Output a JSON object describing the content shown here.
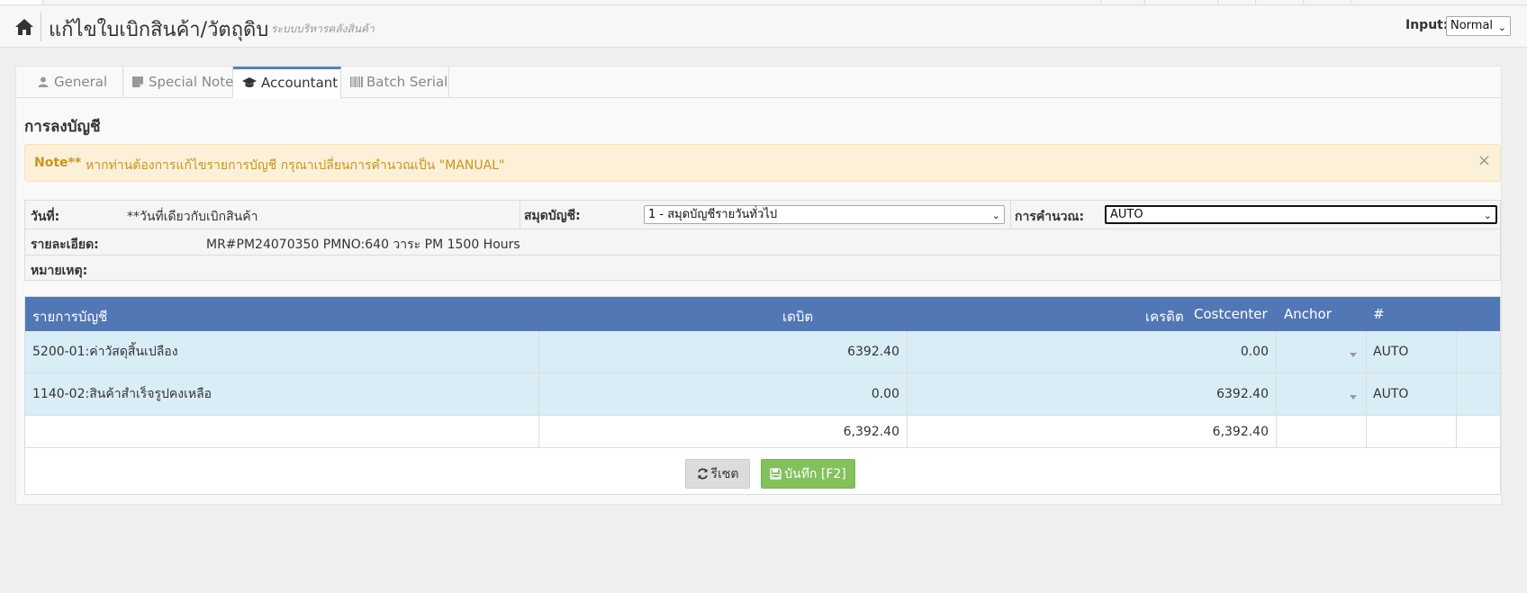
{
  "header": {
    "title": "แก้ไขใบเบิกสินค้า/วัตถุดิบ",
    "subtitle": "ระบบบริหารคลังสินค้า",
    "input_label": "Input:",
    "input_value": "Normal"
  },
  "tabs": [
    {
      "label": "General",
      "icon": "user-icon"
    },
    {
      "label": "Special Note",
      "icon": "sticky-note-icon"
    },
    {
      "label": "Accountant",
      "icon": "graduation-cap-icon",
      "active": true
    },
    {
      "label": "Batch Serial",
      "icon": "barcode-icon"
    }
  ],
  "section": {
    "title": "การลงบัญชี"
  },
  "note": {
    "strong": "Note**",
    "text": "หากท่านต้องการแก้ไขรายการบัญชี กรุณาเปลี่ยนการคำนวณเป็น \"MANUAL\"",
    "close": "×"
  },
  "info": {
    "date_label": "วันที่:",
    "date_value": "**วันที่เดียวกับเบิกสินค้า",
    "journal_label": "สมุดบัญชี:",
    "journal_value": "1 - สมุดบัญชีรายวันทั่วไป",
    "calc_label": "การคำนวณ:",
    "calc_value": "AUTO",
    "detail_label": "รายละเอียด:",
    "detail_value": "MR#PM24070350 PMNO:640  วาระ PM 1500 Hours",
    "remark_label": "หมายเหตุ:"
  },
  "table": {
    "headers": {
      "account": "รายการบัญชี",
      "debit": "เดบิต",
      "credit": "เครดิต",
      "costcenter": "Costcenter",
      "anchor": "Anchor",
      "hash": "#"
    },
    "rows": [
      {
        "account": "5200-01:ค่าวัสดุสิ้นเปลือง",
        "debit": "6392.40",
        "credit": "0.00",
        "anchor": "AUTO"
      },
      {
        "account": "1140-02:สินค้าสำเร็จรูปคงเหลือ",
        "debit": "0.00",
        "credit": "6392.40",
        "anchor": "AUTO"
      }
    ],
    "total": {
      "debit": "6,392.40",
      "credit": "6,392.40"
    }
  },
  "buttons": {
    "reset": "รีเซต",
    "save": "บันทึก [F2]"
  },
  "colors": {
    "table_header": "#5277b5",
    "row_highlight": "#d9edf7",
    "note_bg": "#fcf0d8",
    "note_text": "#c7951f",
    "save_button": "#82c15c",
    "tab_active_border": "#5a7fb5"
  }
}
